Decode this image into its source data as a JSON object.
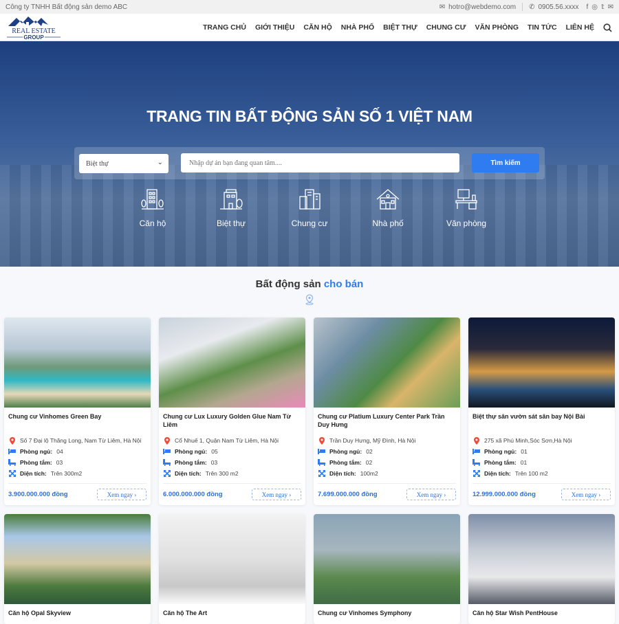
{
  "topbar": {
    "company": "Công ty TNHH Bất động sản demo ABC",
    "email": "hotro@webdemo.com",
    "phone": "0905.56.xxxx",
    "social": [
      "facebook-icon",
      "instagram-icon",
      "twitter-icon",
      "mail-icon"
    ]
  },
  "logo": {
    "line1": "REAL ESTATE",
    "line2": "GROUP"
  },
  "nav": {
    "items": [
      "TRANG CHỦ",
      "GIỚI THIỆU",
      "CĂN HỘ",
      "NHÀ PHỐ",
      "BIỆT THỰ",
      "CHUNG CƯ",
      "VĂN PHÒNG",
      "TIN TỨC",
      "LIÊN HỆ"
    ]
  },
  "hero": {
    "title": "TRANG TIN BẤT ĐỘNG SẢN SỐ 1 VIỆT NAM",
    "select_value": "Biệt thự",
    "search_placeholder": "Nhập dự án bạn đang quan tâm....",
    "search_button": "Tìm kiếm",
    "categories": [
      {
        "label": "Căn hộ",
        "icon": "apartment-icon"
      },
      {
        "label": "Biệt thự",
        "icon": "villa-icon"
      },
      {
        "label": "Chung cư",
        "icon": "condo-icon"
      },
      {
        "label": "Nhà phố",
        "icon": "house-icon"
      },
      {
        "label": "Văn phòng",
        "icon": "office-icon"
      }
    ]
  },
  "section": {
    "title_a": "Bất động sản",
    "title_b": "cho bán"
  },
  "labels": {
    "bed": "Phòng ngủ:",
    "bath": "Phòng tắm:",
    "area": "Diện tích:",
    "more": "Xem ngay ›"
  },
  "accent": "#2f7cf0",
  "listings": [
    {
      "title": "Chung cư Vinhomes Green Bay",
      "address": "Số 7 Đại lộ Thăng Long, Nam Từ Liêm, Hà Nội",
      "bed": "04",
      "bath": "03",
      "area": "Trên 300m2",
      "price": "3.900.000.000 đồng"
    },
    {
      "title": "Chung cư Lux Luxury Golden Glue Nam Từ Liêm",
      "address": "Cổ Nhuế 1, Quận Nam Từ Liêm, Hà Nội",
      "bed": "05",
      "bath": "03",
      "area": "Trên 300 m2",
      "price": "6.000.000.000 đồng"
    },
    {
      "title": "Chung cư Platium Luxury Center Park Trần Duy Hưng",
      "address": "Trần Duy Hưng, Mỹ Đình, Hà Nội",
      "bed": "02",
      "bath": "02",
      "area": "100m2",
      "price": "7.699.000.000 đồng"
    },
    {
      "title": "Biệt thự sân vườn sát sân bay Nội Bài",
      "address": "275 xã Phú Minh,Sóc Sơn,Hà Nội",
      "bed": "01",
      "bath": "01",
      "area": "Trên 100 m2",
      "price": "12.999.000.000 đồng"
    },
    {
      "title": "Căn hộ Opal Skyview"
    },
    {
      "title": "Căn hộ The Art"
    },
    {
      "title": "Chung cư Vinhomes Symphony"
    },
    {
      "title": "Căn hộ Star Wish PentHouse"
    }
  ]
}
